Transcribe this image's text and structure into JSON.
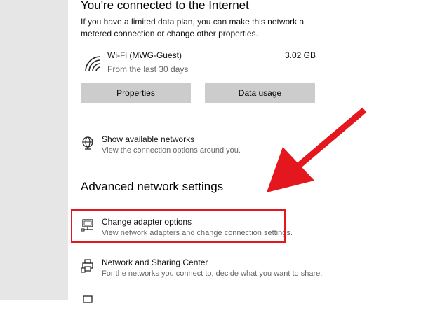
{
  "status": {
    "title": "You're connected to the Internet",
    "description": "If you have a limited data plan, you can make this network a metered connection or change other properties."
  },
  "network": {
    "icon": "wifi-icon",
    "name": "Wi-Fi (MWG-Guest)",
    "period": "From the last 30 days",
    "usage": "3.02 GB"
  },
  "buttons": {
    "properties": "Properties",
    "data_usage": "Data usage"
  },
  "show_networks": {
    "icon": "globe-icon",
    "title": "Show available networks",
    "description": "View the connection options around you."
  },
  "advanced": {
    "heading": "Advanced network settings",
    "items": [
      {
        "icon": "monitor-network-icon",
        "title": "Change adapter options",
        "description": "View network adapters and change connection settings."
      },
      {
        "icon": "printer-share-icon",
        "title": "Network and Sharing Center",
        "description": "For the networks you connect to, decide what you want to share."
      }
    ]
  },
  "annotation": {
    "highlight_color": "#e3171d",
    "arrow_color": "#e3171d"
  }
}
